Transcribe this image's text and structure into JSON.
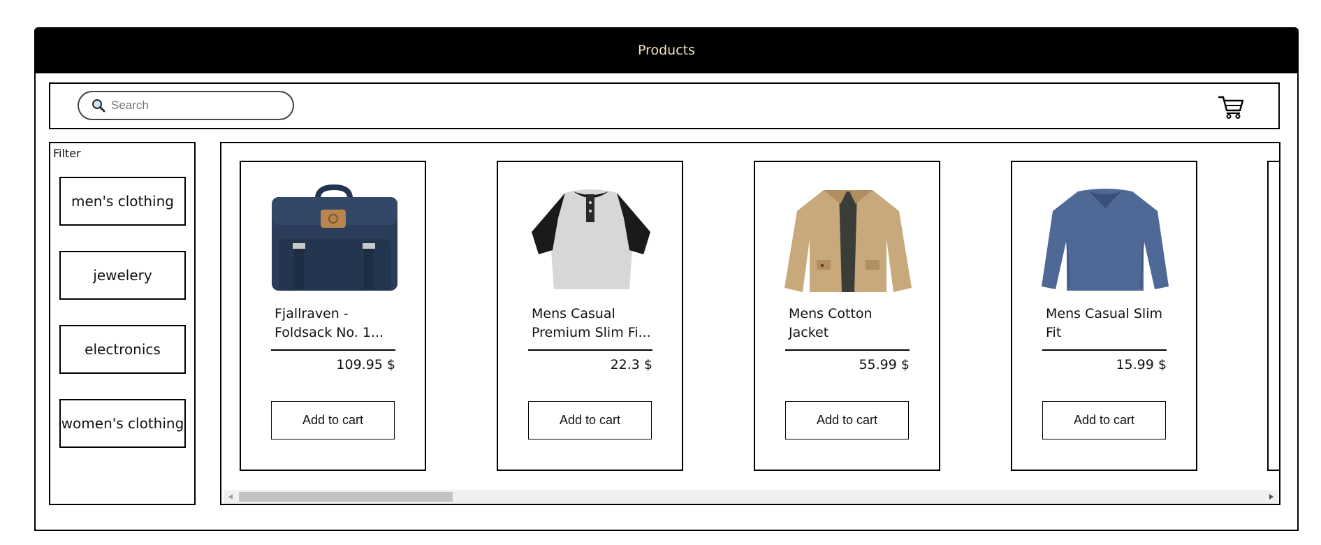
{
  "header": {
    "title": "Products"
  },
  "search": {
    "placeholder": "Search",
    "value": ""
  },
  "icons": {
    "search": "magnifier-icon",
    "cart": "cart-icon"
  },
  "filter": {
    "label": "Filter",
    "items": [
      {
        "label": "men's clothing"
      },
      {
        "label": "jewelery"
      },
      {
        "label": "electronics"
      },
      {
        "label": "women's clothing"
      }
    ]
  },
  "products": [
    {
      "name": "Fjallraven - Foldsack No. 1...",
      "price": "109.95 $",
      "button": "Add to cart",
      "image": "backpack"
    },
    {
      "name": "Mens Casual Premium Slim Fi...",
      "price": "22.3 $",
      "button": "Add to cart",
      "image": "raglan-tshirt"
    },
    {
      "name": "Mens Cotton Jacket",
      "price": "55.99 $",
      "button": "Add to cart",
      "image": "jacket"
    },
    {
      "name": "Mens Casual Slim Fit",
      "price": "15.99 $",
      "button": "Add to cart",
      "image": "longsleeve-tshirt"
    }
  ],
  "colors": {
    "header_bg": "#000000",
    "header_text": "#f4e3c3",
    "border": "#000000",
    "scrollbar_track": "#f0f0f0",
    "scrollbar_thumb": "#c2c2c2"
  },
  "scroll": {
    "horizontal_thumb_fraction": 0.2
  }
}
